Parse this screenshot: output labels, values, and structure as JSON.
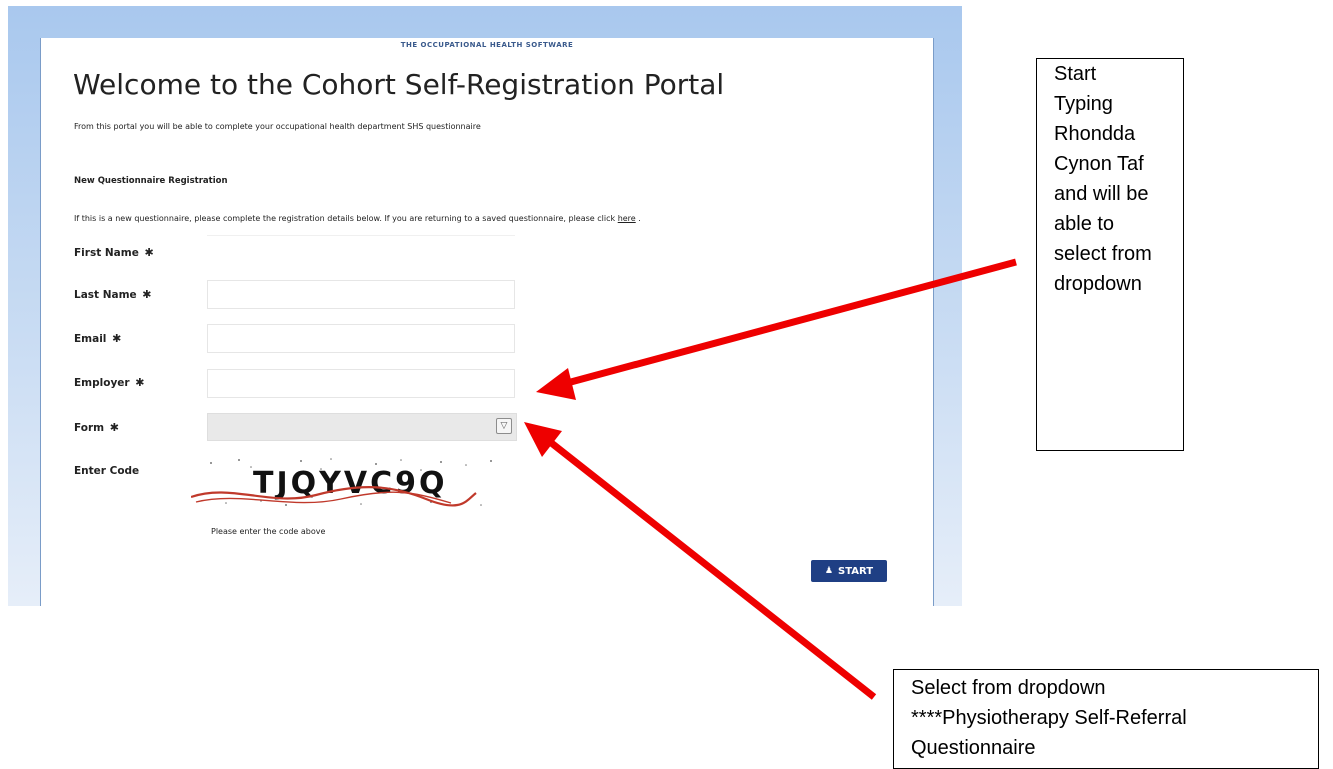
{
  "portal": {
    "brand": "THE OCCUPATIONAL HEALTH SOFTWARE",
    "title": "Welcome to the Cohort Self-Registration Portal",
    "intro": "From this portal you will be able to complete your occupational health department SHS questionnaire",
    "section_title": "New Questionnaire Registration",
    "instructions_text": "If this is a new questionnaire, please complete the registration details below. If you are returning to a saved questionnaire, please click ",
    "instructions_link": "here",
    "instructions_end": " .",
    "required_mark": "✱",
    "form": {
      "first_name_label": "First Name",
      "first_name_value": "",
      "last_name_label": "Last Name",
      "last_name_value": "",
      "email_label": "Email",
      "email_value": "",
      "employer_label": "Employer",
      "employer_value": "",
      "form_label": "Form",
      "form_selected": "",
      "code_label": "Enter Code",
      "captcha_text": "TJQYVC9Q",
      "code_hint": "Please enter the code above"
    },
    "start_button": "START"
  },
  "annotations": {
    "employer_callout": [
      "Start",
      "Typing",
      "Rhondda",
      "Cynon Taf",
      "and will be",
      "able to",
      "select from",
      "dropdown"
    ],
    "form_callout": [
      "Select from dropdown",
      "****Physiotherapy Self-Referral",
      "Questionnaire"
    ],
    "arrow_color": "#ee0000"
  },
  "colors": {
    "button": "#1f3f84",
    "background_top": "#a9c8ee"
  }
}
